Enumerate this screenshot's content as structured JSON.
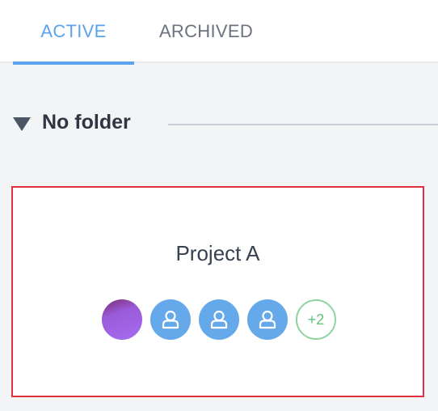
{
  "tabs": [
    {
      "label": "ACTIVE",
      "selected": true
    },
    {
      "label": "ARCHIVED",
      "selected": false
    }
  ],
  "folder": {
    "label": "No folder",
    "icon": "caret-down-icon"
  },
  "project": {
    "title": "Project A",
    "members": [
      {
        "type": "photo"
      },
      {
        "type": "default",
        "icon": "user-icon"
      },
      {
        "type": "default",
        "icon": "user-icon"
      },
      {
        "type": "default",
        "icon": "user-icon"
      }
    ],
    "more_label": "+2"
  },
  "colors": {
    "accent": "#5ba3ea",
    "card_border": "#e0313f",
    "more_badge": "#60c37b"
  }
}
